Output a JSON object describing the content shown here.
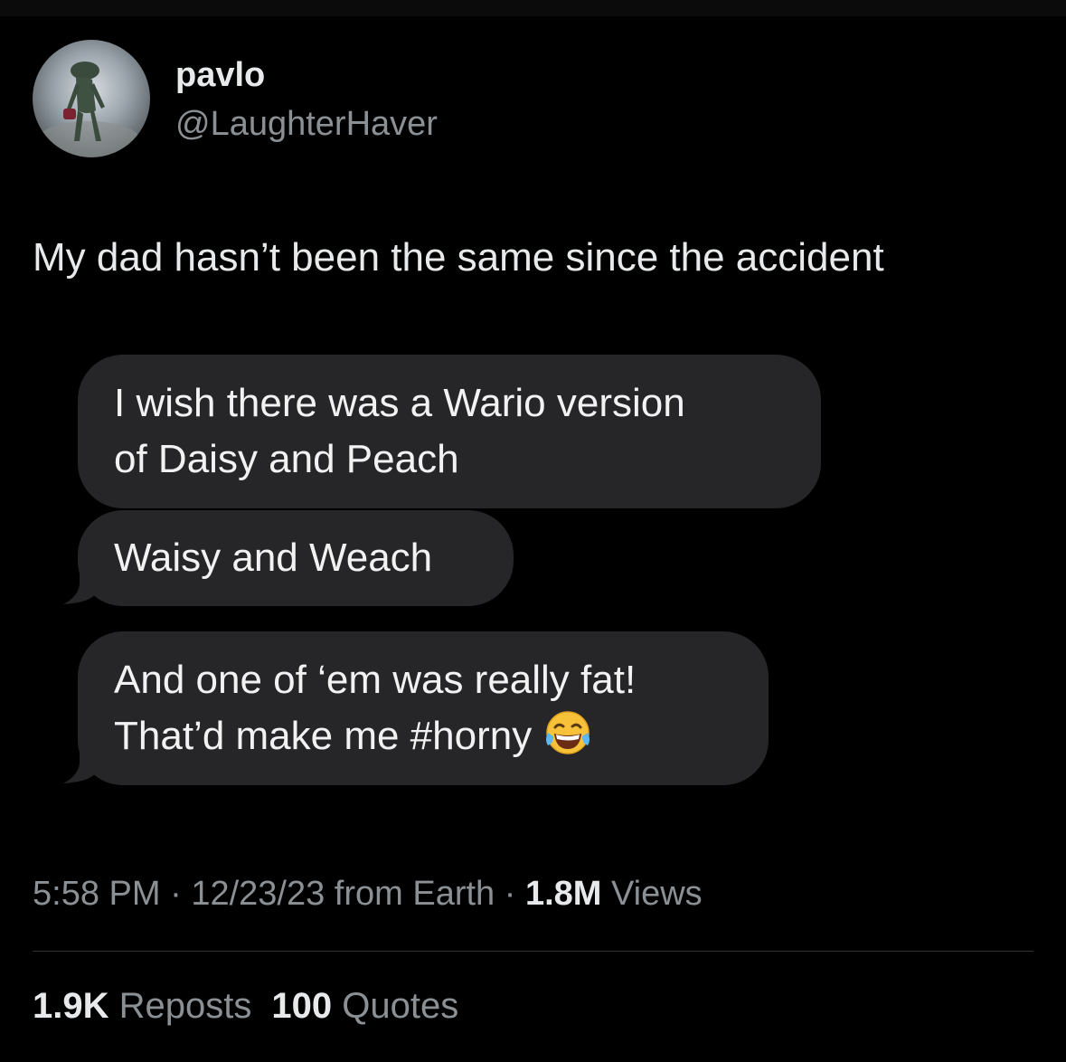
{
  "author": {
    "display_name": "pavlo",
    "handle": "@LaughterHaver",
    "avatar_icon": "profile-avatar"
  },
  "tweet": {
    "text": "My dad hasn’t been the same since the accident"
  },
  "messages": [
    {
      "lines": [
        "I wish there was a Wario version",
        "of Daisy and Peach"
      ]
    },
    {
      "lines": [
        "Waisy and Weach"
      ]
    },
    {
      "lines": [
        "And one of ‘em was really fat!",
        "That’d make me #horny"
      ],
      "emoji": "face-with-tears-of-joy-icon"
    }
  ],
  "meta": {
    "time": "5:58 PM",
    "separator": " · ",
    "date_source": "12/23/23 from Earth",
    "views_count": "1.8M",
    "views_label": " Views"
  },
  "stats": {
    "reposts_count": "1.9K",
    "reposts_label": " Reposts",
    "quotes_count": "100",
    "quotes_label": " Quotes"
  },
  "colors": {
    "background": "#000000",
    "primary_text": "#e7e9ea",
    "secondary_text": "#8b9095",
    "bubble": "#262628",
    "divider": "#2f3336"
  }
}
